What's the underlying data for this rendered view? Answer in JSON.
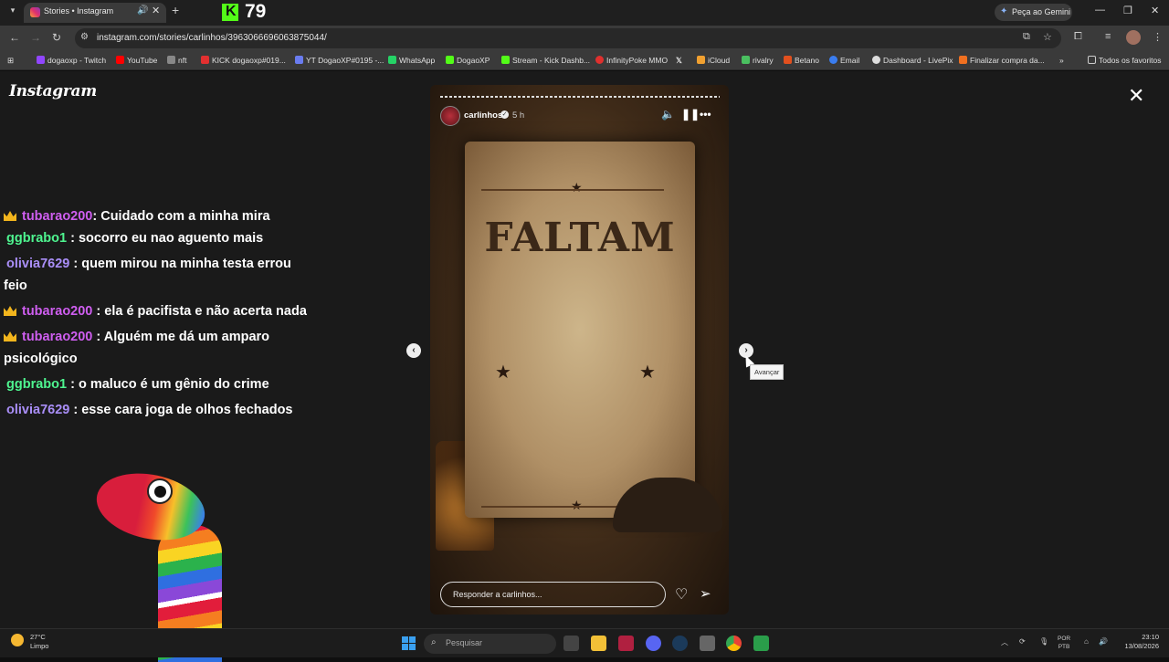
{
  "browser": {
    "tab_title": "Stories • Instagram",
    "new_tab": "+",
    "kick_logo": "K",
    "kick_count": "79",
    "gemini_label": "Peça ao Gemini",
    "url": "instagram.com/stories/carlinhos/3963066696063875044/"
  },
  "bookmarks": [
    {
      "label": "dogaoxp - Twitch",
      "color": "#9146ff"
    },
    {
      "label": "YouTube",
      "color": "#ff0000"
    },
    {
      "label": "nft",
      "color": "#888888"
    },
    {
      "label": "KICK dogaoxp#019...",
      "color": "#e23030"
    },
    {
      "label": "YT DogaoXP#0195 -...",
      "color": "#6a7cf0"
    },
    {
      "label": "WhatsApp",
      "color": "#25d366"
    },
    {
      "label": "DogaoXP",
      "color": "#53fc18"
    },
    {
      "label": "Stream - Kick Dashb...",
      "color": "#53fc18"
    },
    {
      "label": "InfinityPoke MMO",
      "color": "#e0302e"
    },
    {
      "label": "",
      "color": "#dddddd"
    },
    {
      "label": "iCloud",
      "color": "#f0a030"
    },
    {
      "label": "rivalry",
      "color": "#4ac060"
    },
    {
      "label": "Betano",
      "color": "#e2501e"
    },
    {
      "label": "Email",
      "color": "#3a7df0"
    },
    {
      "label": "Dashboard - LivePix",
      "color": "#dddddd"
    },
    {
      "label": "Finalizar compra da...",
      "color": "#f07020"
    }
  ],
  "bookmarks_more": "»",
  "all_bookmarks": "Todos os favoritos",
  "page": {
    "logo": "Instagram",
    "chat": [
      {
        "user": "tubarao200",
        "msg": ": Cuidado com a minha mira",
        "kind": "crown"
      },
      {
        "user": "ggbrabo1",
        "msg": ": socorro eu nao aguento mais",
        "kind": "green"
      },
      {
        "user": "olivia7629",
        "msg": ": quem mirou na minha testa errou feio",
        "kind": "purple"
      },
      {
        "user": "tubarao200",
        "msg": ": ela é pacifista e não acerta nada",
        "kind": "crown"
      },
      {
        "user": "tubarao200",
        "msg": ": Alguém me dá um amparo psicológico",
        "kind": "crown"
      },
      {
        "user": "ggbrabo1",
        "msg": ": o maluco é um gênio do crime",
        "kind": "green"
      },
      {
        "user": "olivia7629",
        "msg": ": esse cara joga de olhos fechados",
        "kind": "purple"
      }
    ],
    "story": {
      "username": "carlinhos",
      "time": "5 h",
      "poster_title": "FALTAM",
      "reply_placeholder": "Responder a carlinhos..."
    },
    "tooltip": "Avançar"
  },
  "taskbar": {
    "temp": "27°C",
    "weather": "Limpo",
    "search": "Pesquisar",
    "lang1": "POR",
    "lang2": "PTB",
    "time": "23:10",
    "date": "13/08/2026"
  }
}
